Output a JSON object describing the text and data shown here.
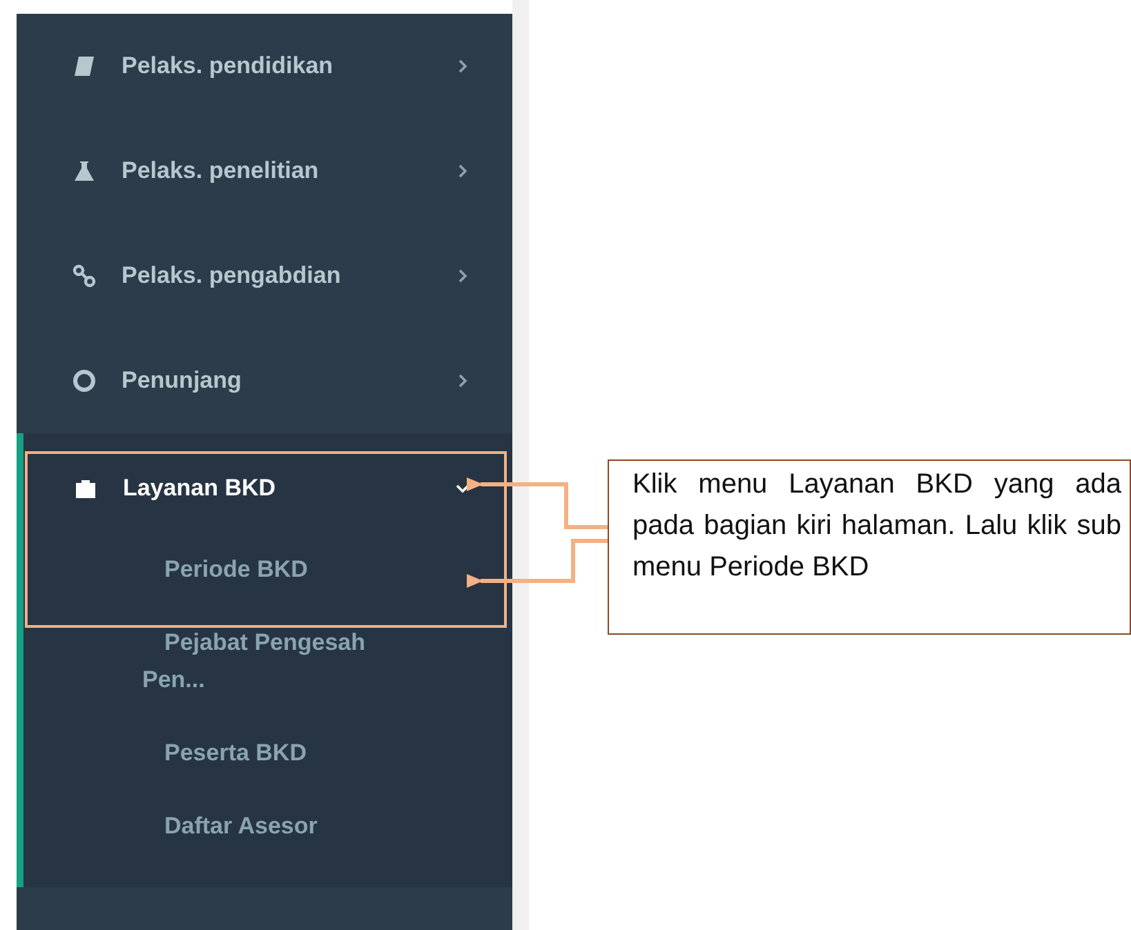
{
  "sidebar": {
    "items": [
      {
        "label": "Pelaks. pendidikan",
        "expanded": false
      },
      {
        "label": "Pelaks. penelitian",
        "expanded": false
      },
      {
        "label": "Pelaks. pengabdian",
        "expanded": false
      },
      {
        "label": "Penunjang",
        "expanded": false
      },
      {
        "label": "Layanan BKD",
        "expanded": true,
        "children": [
          {
            "label": "Periode BKD"
          },
          {
            "label": "Pejabat Pengesah Pen..."
          },
          {
            "label": "Peserta BKD"
          },
          {
            "label": "Daftar Asesor"
          }
        ]
      }
    ]
  },
  "callout": {
    "text": "Klik menu Layanan BKD yang ada pada bagian kiri halaman. Lalu klik sub menu Periode BKD"
  }
}
